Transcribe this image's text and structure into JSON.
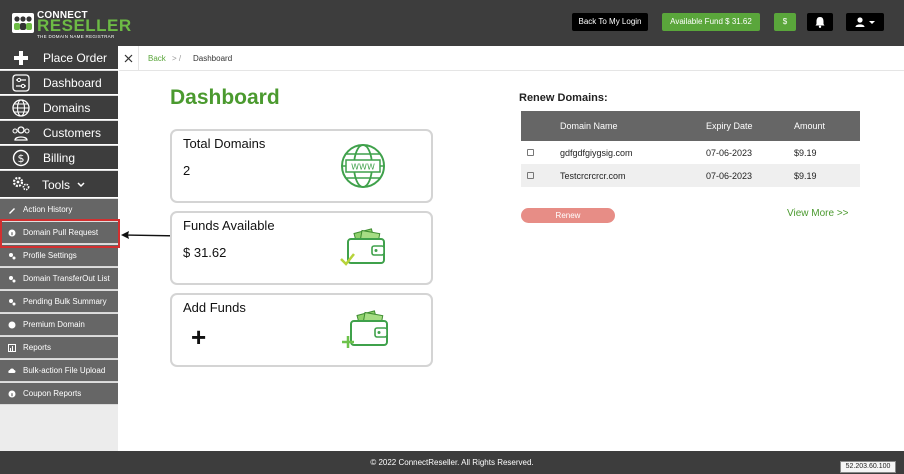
{
  "header": {
    "logo_line1": "CONNECT",
    "logo_line2": "RESELLER",
    "logo_tagline": "THE DOMAIN NAME REGISTRAR",
    "back_to_login": "Back To My Login",
    "available_fund": "Available Fund  $ 31.62",
    "dollar_btn": "$"
  },
  "sidebar": {
    "main": [
      {
        "label": "Place Order",
        "icon": "plus-icon"
      },
      {
        "label": "Dashboard",
        "icon": "sliders-icon"
      },
      {
        "label": "Domains",
        "icon": "globe-icon"
      },
      {
        "label": "Customers",
        "icon": "users-icon"
      },
      {
        "label": "Billing",
        "icon": "dollar-circle-icon"
      },
      {
        "label": "Tools",
        "icon": "cogs-icon"
      }
    ],
    "sub": [
      {
        "label": "Action History"
      },
      {
        "label": "Domain Pull Request"
      },
      {
        "label": "Profile Settings"
      },
      {
        "label": "Domain TransferOut List"
      },
      {
        "label": "Pending Bulk Summary"
      },
      {
        "label": "Premium Domain"
      },
      {
        "label": "Reports"
      },
      {
        "label": "Bulk-action File Upload"
      },
      {
        "label": "Coupon Reports"
      }
    ]
  },
  "breadcrumb": {
    "back": "Back",
    "sep": "> /",
    "current": "Dashboard"
  },
  "main": {
    "title": "Dashboard",
    "cards": [
      {
        "title": "Total Domains",
        "value": "2",
        "icon": "www-globe-icon"
      },
      {
        "title": "Funds Available",
        "value": "$ 31.62",
        "icon": "wallet-check-icon"
      },
      {
        "title": "Add Funds",
        "value": "+",
        "icon": "wallet-plus-icon"
      }
    ]
  },
  "renew": {
    "title": "Renew Domains:",
    "columns": [
      "",
      "Domain Name",
      "Expiry Date",
      "Amount"
    ],
    "rows": [
      {
        "domain": "gdfgdfgiygsig.com",
        "expiry": "07-06-2023",
        "amount": "$9.19"
      },
      {
        "domain": "Testcrcrcrcr.com",
        "expiry": "07-06-2023",
        "amount": "$9.19"
      }
    ],
    "renew_btn": "Renew",
    "view_more": "View More >>"
  },
  "footer": {
    "copyright": "© 2022 ConnectReseller. All Rights Reserved.",
    "ip": "52.203.60.100"
  },
  "colors": {
    "brand_green": "#5aa63b",
    "title_green": "#4b9a2f",
    "dark": "#3d3d3d",
    "renew_btn": "#e78d86"
  }
}
